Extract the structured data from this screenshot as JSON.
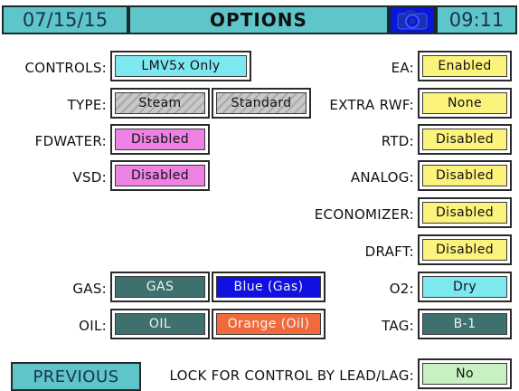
{
  "header": {
    "date": "07/15/15",
    "title": "OPTIONS",
    "time": "09:11",
    "camera_icon": "camera-icon"
  },
  "left": {
    "controls": {
      "label": "CONTROLS:",
      "value": "LMV5x Only"
    },
    "type": {
      "label": "TYPE:",
      "value1": "Steam",
      "value2": "Standard"
    },
    "fdwater": {
      "label": "FDWATER:",
      "value": "Disabled"
    },
    "vsd": {
      "label": "VSD:",
      "value": "Disabled"
    },
    "gas": {
      "label": "GAS:",
      "value": "GAS",
      "color": "Blue (Gas)"
    },
    "oil": {
      "label": "OIL:",
      "value": "OIL",
      "color": "Orange (Oil)"
    }
  },
  "right": {
    "ea": {
      "label": "EA:",
      "value": "Enabled"
    },
    "extra_rwf": {
      "label": "EXTRA RWF:",
      "value": "None"
    },
    "rtd": {
      "label": "RTD:",
      "value": "Disabled"
    },
    "analog": {
      "label": "ANALOG:",
      "value": "Disabled"
    },
    "economizer": {
      "label": "ECONOMIZER:",
      "value": "Disabled"
    },
    "draft": {
      "label": "DRAFT:",
      "value": "Disabled"
    },
    "o2": {
      "label": "O2:",
      "value": "Dry"
    },
    "tag": {
      "label": "TAG:",
      "value": "B-1"
    }
  },
  "footer": {
    "previous": "PREVIOUS",
    "lock_label": "LOCK FOR CONTROL BY LEAD/LAG:",
    "lock_value": "No"
  },
  "colors": {
    "header": "#5ec6c8",
    "camera": "#0b17d8",
    "cyan": "#7ee8f0",
    "yellow": "#fbf37c",
    "pink": "#ee82e4",
    "teal": "#3e7070",
    "blue": "#1010e0",
    "orange": "#f06a3c",
    "green": "#c8f0c0"
  }
}
